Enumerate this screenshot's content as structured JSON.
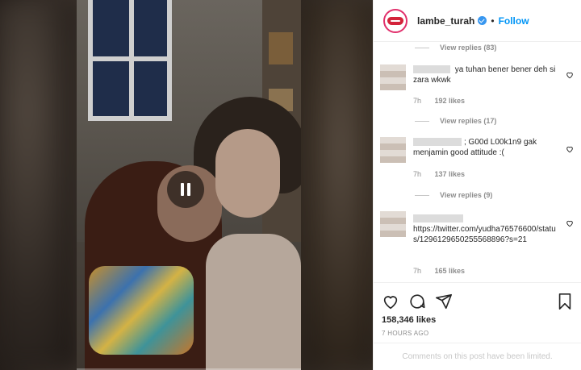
{
  "header": {
    "username": "lambe_turah",
    "separator": "•",
    "follow_label": "Follow"
  },
  "replies": [
    {
      "label": "View replies (83)"
    },
    {
      "label": "View replies (17)"
    },
    {
      "label": "View replies (9)"
    }
  ],
  "comments": [
    {
      "text": "ya tuhan bener bener deh si zara wkwk",
      "age": "7h",
      "likes": "192 likes"
    },
    {
      "text": "; G00d L00k1n9 gak menjamin good attitude :(",
      "age": "7h",
      "likes": "137 likes"
    },
    {
      "text": "https://twitter.com/yudha76576600/status/1296129650255568896?s=21",
      "age": "7h",
      "likes": "165 likes"
    }
  ],
  "post": {
    "like_count": "158,346 likes",
    "time_ago": "7 HOURS AGO",
    "comments_status": "Comments on this post have been limited."
  },
  "icons": [
    "pause-icon",
    "verified-icon",
    "heart-icon",
    "comment-icon",
    "share-icon",
    "bookmark-icon"
  ],
  "colors": {
    "accent": "#0095f6",
    "text": "#262626",
    "muted": "#8e8e8e"
  }
}
